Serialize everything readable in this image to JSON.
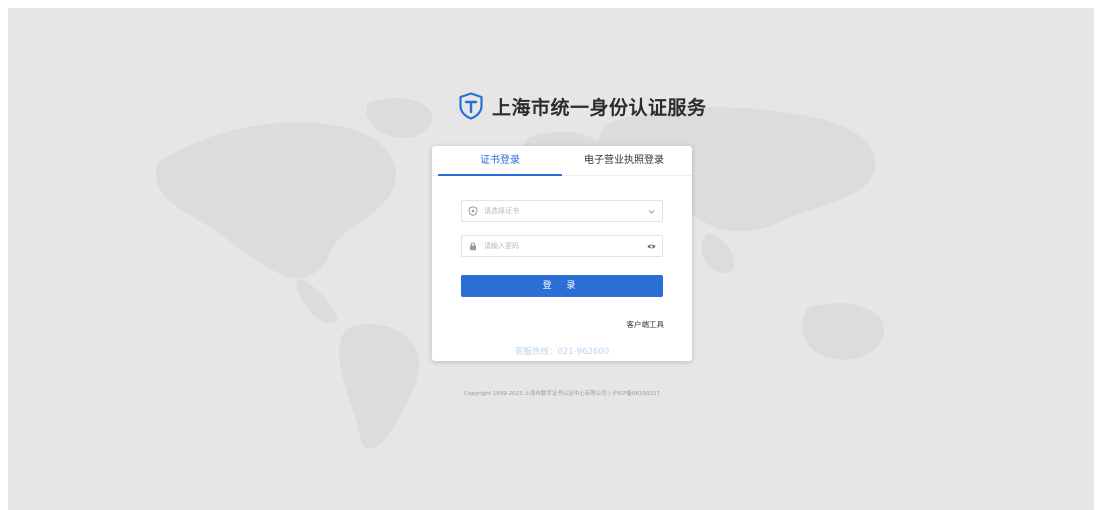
{
  "brand": {
    "icon": "shield-t-logo",
    "title": "上海市统一身份认证服务"
  },
  "tabs": [
    {
      "label": "证书登录",
      "active": true
    },
    {
      "label": "电子营业执照登录",
      "active": false
    }
  ],
  "form": {
    "cert_placeholder": "请选择证书",
    "password_placeholder": "请输入密码",
    "login_label": "登 录",
    "client_tool_label": "客户端工具"
  },
  "hotline": {
    "label": "客服热线：",
    "number": "021-962600"
  },
  "copyright": "Copyright 1999-2023 上海市数字证书认证中心有限公司 | 沪ICP备06100327",
  "colors": {
    "accent": "#2b6fd6",
    "background": "#e6e6e6"
  }
}
